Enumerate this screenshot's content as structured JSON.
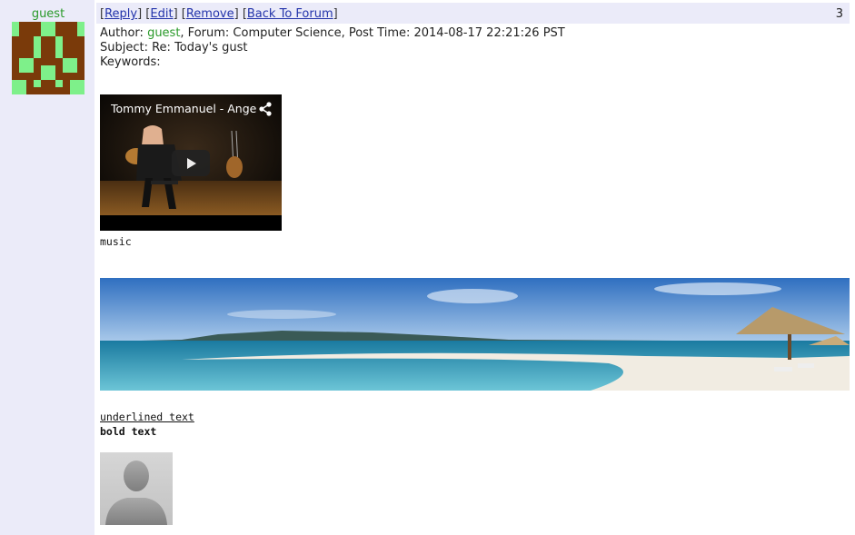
{
  "sidebar": {
    "username": "guest",
    "colors": {
      "background": "#ebebf9",
      "username": "#2a9a2a",
      "avatar_dark": "#7a3a0a",
      "avatar_light": "#7ef08a"
    }
  },
  "post": {
    "actions": [
      {
        "label": "Reply"
      },
      {
        "label": "Edit"
      },
      {
        "label": "Remove"
      },
      {
        "label": "Back To Forum"
      }
    ],
    "post_number": "3",
    "author_label": "Author: ",
    "author": "guest",
    "forum_info": ", Forum: Computer Science, Post Time: 2014-08-17 22:21:26 PST",
    "subject_line": "Subject: Re: Today's gust",
    "keywords_line": "Keywords:",
    "video": {
      "title": "Tommy Emmanuel - Angel",
      "icons": [
        "share-icon",
        "play-icon"
      ]
    },
    "music_caption": "music",
    "underlined_text": "underlined text",
    "bold_text": "bold text"
  },
  "colors": {
    "link": "#2233aa",
    "topbar": "#ebebf9"
  }
}
